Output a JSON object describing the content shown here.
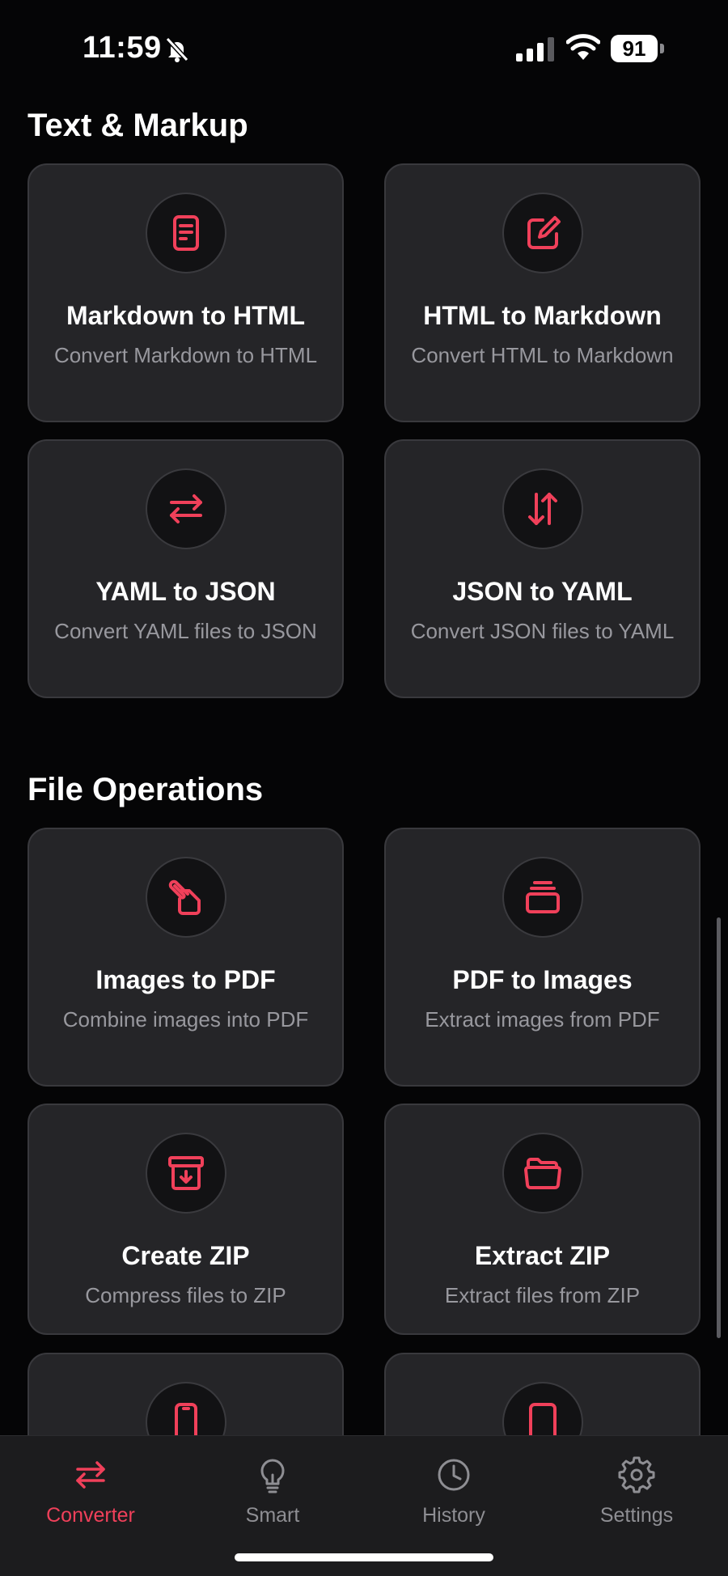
{
  "status_bar": {
    "time": "11:59",
    "battery": "91"
  },
  "sections": [
    {
      "title": "Text & Markup",
      "cards": [
        {
          "title": "Markdown to HTML",
          "desc": "Convert Markdown to HTML",
          "icon": "document-icon"
        },
        {
          "title": "HTML to Markdown",
          "desc": "Convert HTML to Markdown",
          "icon": "edit-icon"
        },
        {
          "title": "YAML to JSON",
          "desc": "Convert YAML files to JSON",
          "icon": "swap-arrows-icon"
        },
        {
          "title": "JSON to YAML",
          "desc": "Convert JSON files to YAML",
          "icon": "up-down-arrows-icon"
        }
      ]
    },
    {
      "title": "File Operations",
      "cards": [
        {
          "title": "Images to PDF",
          "desc": "Combine images into PDF",
          "icon": "paperclip-document-icon"
        },
        {
          "title": "PDF to Images",
          "desc": "Extract images from PDF",
          "icon": "stacked-pages-icon"
        },
        {
          "title": "Create ZIP",
          "desc": "Compress files to ZIP",
          "icon": "archive-icon"
        },
        {
          "title": "Extract ZIP",
          "desc": "Extract files from ZIP",
          "icon": "open-folder-icon"
        },
        {
          "title": "",
          "desc": "",
          "icon": "phone-icon"
        },
        {
          "title": "",
          "desc": "",
          "icon": "tablet-icon"
        }
      ]
    }
  ],
  "tab_bar": {
    "tabs": [
      {
        "label": "Converter",
        "icon": "swap-arrows-icon",
        "active": true
      },
      {
        "label": "Smart",
        "icon": "lightbulb-icon",
        "active": false
      },
      {
        "label": "History",
        "icon": "clock-icon",
        "active": false
      },
      {
        "label": "Settings",
        "icon": "gear-icon",
        "active": false
      }
    ]
  },
  "colors": {
    "accent": "#f0405a",
    "background": "#050506",
    "card": "#252528",
    "muted_text": "#98989e"
  }
}
